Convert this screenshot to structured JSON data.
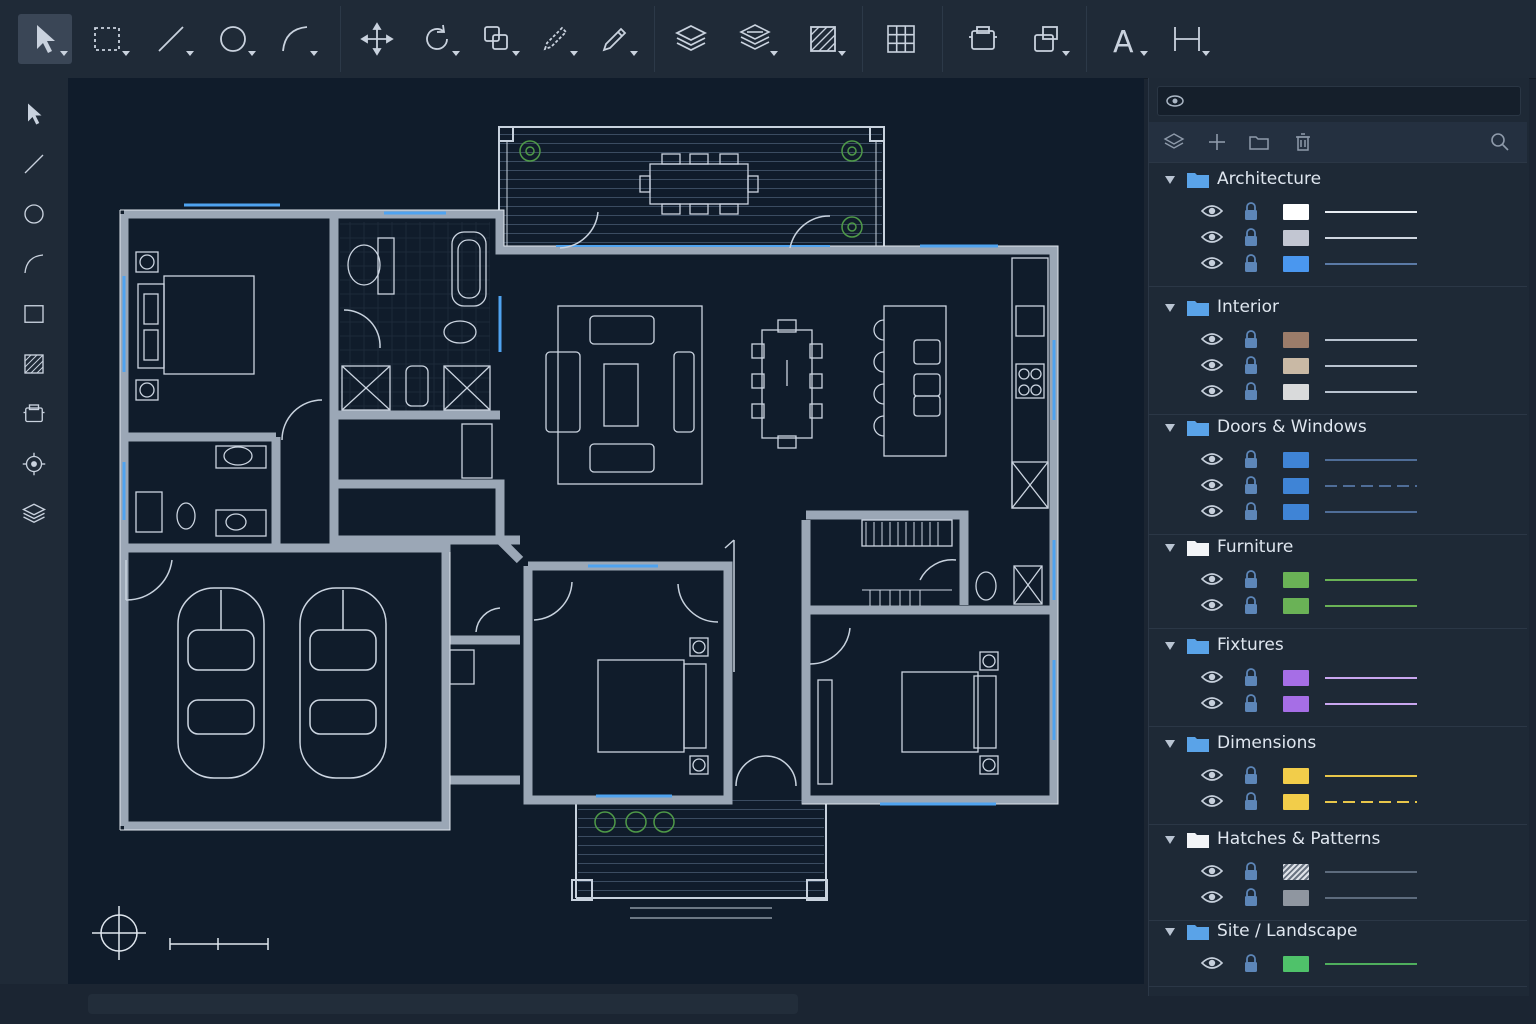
{
  "toolbar": {
    "tools": [
      {
        "id": "select",
        "icon": "select-arrow-icon",
        "active": true,
        "dropdown": true
      },
      {
        "id": "marquee",
        "icon": "marquee-select-icon",
        "dropdown": true
      },
      {
        "id": "line",
        "icon": "line-tool-icon",
        "dropdown": true
      },
      {
        "id": "circle",
        "icon": "circle-tool-icon",
        "dropdown": true
      },
      {
        "id": "arc",
        "icon": "arc-tool-icon",
        "dropdown": true
      },
      {
        "id": "move",
        "icon": "move-icon",
        "dropdown": false
      },
      {
        "id": "rotate",
        "icon": "rotate-icon",
        "dropdown": true
      },
      {
        "id": "copy",
        "icon": "copy-icon",
        "dropdown": true
      },
      {
        "id": "pen",
        "icon": "pen-icon",
        "dropdown": true
      },
      {
        "id": "pencil",
        "icon": "pencil-icon",
        "dropdown": true
      },
      {
        "id": "layers",
        "icon": "layers-icon",
        "dropdown": false
      },
      {
        "id": "layer-manager",
        "icon": "layer-manager-icon",
        "dropdown": true
      },
      {
        "id": "hatch",
        "icon": "hatch-icon",
        "dropdown": true
      },
      {
        "id": "grid",
        "icon": "grid-icon",
        "dropdown": false
      },
      {
        "id": "block",
        "icon": "block-icon",
        "dropdown": false
      },
      {
        "id": "block-insert",
        "icon": "block-insert-icon",
        "dropdown": true
      },
      {
        "id": "text",
        "icon": "text-tool-icon",
        "label": "A",
        "dropdown": true
      },
      {
        "id": "dimension",
        "icon": "dimension-tool-icon",
        "dropdown": true
      }
    ]
  },
  "left_tools": [
    {
      "id": "select",
      "icon": "select-arrow-icon"
    },
    {
      "id": "line",
      "icon": "line-tool-icon"
    },
    {
      "id": "circle",
      "icon": "circle-tool-icon"
    },
    {
      "id": "arc",
      "icon": "arc-tool-icon"
    },
    {
      "id": "rectangle",
      "icon": "rectangle-tool-icon"
    },
    {
      "id": "hatch",
      "icon": "hatch-icon"
    },
    {
      "id": "block",
      "icon": "block-icon"
    },
    {
      "id": "snap",
      "icon": "snap-icon"
    },
    {
      "id": "layers",
      "icon": "layers-icon"
    }
  ],
  "layers_panel": {
    "search_value": "",
    "tools": [
      "layers-icon",
      "add-layer-icon",
      "new-folder-icon",
      "delete-icon",
      "search-icon"
    ],
    "groups": [
      {
        "name": "Architecture",
        "folder_color": "#5aa3e8",
        "layers": [
          {
            "color": "#ffffff",
            "line": "#e8edf3",
            "style": "solid"
          },
          {
            "color": "#c2c6d2",
            "line": "#cfd6e0",
            "style": "solid"
          },
          {
            "color": "#4a97ef",
            "line": "#5b7aa6",
            "style": "solid"
          }
        ]
      },
      {
        "name": "Interior",
        "folder_color": "#5aa3e8",
        "layers": [
          {
            "color": "#9b7c6a",
            "line": "#b8c2cf",
            "style": "solid"
          },
          {
            "color": "#c9b9a5",
            "line": "#b8c2cf",
            "style": "solid"
          },
          {
            "color": "#d9dadb",
            "line": "#b8c2cf",
            "style": "solid"
          }
        ]
      },
      {
        "name": "Doors & Windows",
        "folder_color": "#5aa3e8",
        "layers": [
          {
            "color": "#3f84d6",
            "line": "#4f6d98",
            "style": "solid"
          },
          {
            "color": "#3f84d6",
            "line": "#4f6d98",
            "style": "dashed"
          },
          {
            "color": "#3f84d6",
            "line": "#4f6d98",
            "style": "solid"
          }
        ]
      },
      {
        "name": "Furniture",
        "folder_color": "#f2f4f7",
        "layers": [
          {
            "color": "#6ab256",
            "line": "#6ab256",
            "style": "solid"
          },
          {
            "color": "#6ab256",
            "line": "#6ab256",
            "style": "solid"
          }
        ]
      },
      {
        "name": "Fixtures",
        "folder_color": "#5aa3e8",
        "layers": [
          {
            "color": "#a66ee6",
            "line": "#c9a6ef",
            "style": "solid"
          },
          {
            "color": "#a66ee6",
            "line": "#c9a6ef",
            "style": "solid"
          }
        ]
      },
      {
        "name": "Dimensions",
        "folder_color": "#5aa3e8",
        "layers": [
          {
            "color": "#f2cd4a",
            "line": "#e8c64a",
            "style": "solid"
          },
          {
            "color": "#f2cd4a",
            "line": "#e8c64a",
            "style": "dashed"
          }
        ]
      },
      {
        "name": "Hatches & Patterns",
        "folder_color": "#f2f4f7",
        "layers": [
          {
            "color": "hatch",
            "line": "#5d6b7d",
            "style": "solid"
          },
          {
            "color": "#8f96a0",
            "line": "#5d6b7d",
            "style": "solid"
          }
        ]
      },
      {
        "name": "Site / Landscape",
        "folder_color": "#5aa3e8",
        "layers": [
          {
            "color": "#4fc26a",
            "line": "#4fae5d",
            "style": "solid"
          }
        ]
      }
    ]
  }
}
